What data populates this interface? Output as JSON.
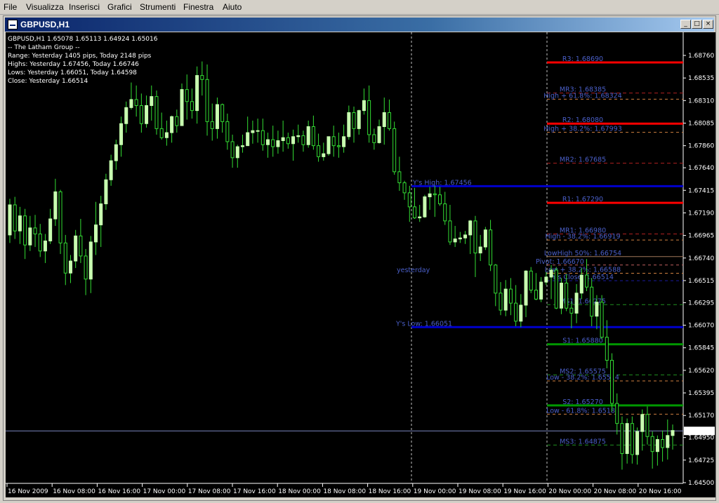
{
  "menu": [
    "File",
    "Visualizza",
    "Inserisci",
    "Grafici",
    "Strumenti",
    "Finestra",
    "Aiuto"
  ],
  "window": {
    "title": "GBPUSD,H1",
    "min": "_",
    "max": "□",
    "close": "×"
  },
  "info": [
    "GBPUSD,H1  1.65078 1.65113 1.64924 1.65016",
    "-- The Latham Group --",
    "Range: Yesterday 1405 pips, Today 2148 pips",
    "Highs: Yesterday 1.67456, Today 1.66746",
    "Lows:  Yesterday 1.66051, Today 1.64598",
    "Close: Yesterday 1.66514"
  ],
  "current_price": "1.65016",
  "colors": {
    "bull": "#c8ffb0",
    "bear": "#000000",
    "wick": "#33dd33",
    "resistance": "#ff0000",
    "support": "#009900",
    "yline": "#0000cc",
    "mid": "#4a5fc8",
    "fib": "#d08040"
  },
  "chart_data": {
    "type": "candlestick",
    "symbol": "GBPUSD",
    "timeframe": "H1",
    "ylim": [
      1.645,
      1.6895
    ],
    "y_ticks": [
      "1.68760",
      "1.68535",
      "1.68310",
      "1.68085",
      "1.67860",
      "1.67640",
      "1.67415",
      "1.67190",
      "1.66965",
      "1.66740",
      "1.66515",
      "1.66295",
      "1.66070",
      "1.65845",
      "1.65620",
      "1.65395",
      "1.65170",
      "1.64950",
      "1.64725",
      "1.64500"
    ],
    "x_ticks": [
      "16 Nov 2009",
      "16 Nov 08:00",
      "16 Nov 16:00",
      "17 Nov 00:00",
      "17 Nov 08:00",
      "17 Nov 16:00",
      "18 Nov 00:00",
      "18 Nov 08:00",
      "18 Nov 16:00",
      "19 Nov 00:00",
      "19 Nov 08:00",
      "19 Nov 16:00",
      "20 Nov 00:00",
      "20 Nov 08:00",
      "20 Nov 16:00"
    ],
    "candles": [
      [
        1.6697,
        1.6733,
        1.6689,
        1.6727
      ],
      [
        1.6727,
        1.6735,
        1.6693,
        1.6701
      ],
      [
        1.6701,
        1.6725,
        1.6688,
        1.6716
      ],
      [
        1.6716,
        1.6723,
        1.6673,
        1.6687
      ],
      [
        1.6687,
        1.6716,
        1.6681,
        1.6704
      ],
      [
        1.6704,
        1.6717,
        1.6685,
        1.6698
      ],
      [
        1.6698,
        1.6708,
        1.6675,
        1.6681
      ],
      [
        1.6681,
        1.6698,
        1.6669,
        1.6691
      ],
      [
        1.6691,
        1.6723,
        1.6688,
        1.6713
      ],
      [
        1.6713,
        1.6753,
        1.6706,
        1.674
      ],
      [
        1.674,
        1.6742,
        1.6678,
        1.6689
      ],
      [
        1.6689,
        1.6697,
        1.6647,
        1.6659
      ],
      [
        1.6659,
        1.6677,
        1.6649,
        1.6671
      ],
      [
        1.6671,
        1.6702,
        1.6664,
        1.6696
      ],
      [
        1.6696,
        1.6713,
        1.6669,
        1.6676
      ],
      [
        1.6676,
        1.6683,
        1.6637,
        1.6653
      ],
      [
        1.6653,
        1.6696,
        1.6639,
        1.669
      ],
      [
        1.669,
        1.673,
        1.6677,
        1.6707
      ],
      [
        1.6707,
        1.6736,
        1.6685,
        1.6728
      ],
      [
        1.6728,
        1.6758,
        1.6722,
        1.6752
      ],
      [
        1.6752,
        1.6777,
        1.6746,
        1.6771
      ],
      [
        1.6771,
        1.6792,
        1.6762,
        1.6787
      ],
      [
        1.6787,
        1.6815,
        1.6775,
        1.6808
      ],
      [
        1.6808,
        1.683,
        1.6799,
        1.6824
      ],
      [
        1.6824,
        1.6849,
        1.6822,
        1.6832
      ],
      [
        1.6832,
        1.6846,
        1.6815,
        1.6826
      ],
      [
        1.6826,
        1.6838,
        1.6799,
        1.6808
      ],
      [
        1.6808,
        1.6836,
        1.6804,
        1.6826
      ],
      [
        1.6826,
        1.6846,
        1.6811,
        1.6835
      ],
      [
        1.6835,
        1.6841,
        1.6797,
        1.6803
      ],
      [
        1.6803,
        1.6819,
        1.6792,
        1.6794
      ],
      [
        1.6794,
        1.6811,
        1.6786,
        1.6799
      ],
      [
        1.6799,
        1.6816,
        1.6789,
        1.6815
      ],
      [
        1.6815,
        1.6822,
        1.6799,
        1.6806
      ],
      [
        1.6806,
        1.6848,
        1.6806,
        1.6842
      ],
      [
        1.6842,
        1.6857,
        1.6812,
        1.683
      ],
      [
        1.683,
        1.6843,
        1.6813,
        1.6821
      ],
      [
        1.6821,
        1.6865,
        1.6808,
        1.6856
      ],
      [
        1.6856,
        1.687,
        1.6836,
        1.6852
      ],
      [
        1.6852,
        1.6867,
        1.6796,
        1.681
      ],
      [
        1.681,
        1.6828,
        1.6791,
        1.6803
      ],
      [
        1.6803,
        1.6834,
        1.6793,
        1.6827
      ],
      [
        1.6827,
        1.6828,
        1.6799,
        1.681
      ],
      [
        1.681,
        1.6818,
        1.6782,
        1.679
      ],
      [
        1.679,
        1.6797,
        1.6764,
        1.6774
      ],
      [
        1.6774,
        1.6787,
        1.6764,
        1.6785
      ],
      [
        1.6785,
        1.6797,
        1.6779,
        1.6786
      ],
      [
        1.6786,
        1.6815,
        1.6786,
        1.6799
      ],
      [
        1.6799,
        1.6811,
        1.6788,
        1.6801
      ],
      [
        1.6801,
        1.6813,
        1.6789,
        1.6801
      ],
      [
        1.6801,
        1.6813,
        1.6781,
        1.6787
      ],
      [
        1.6787,
        1.6799,
        1.6774,
        1.6792
      ],
      [
        1.6792,
        1.6806,
        1.6775,
        1.6785
      ],
      [
        1.6785,
        1.6801,
        1.6778,
        1.6791
      ],
      [
        1.6791,
        1.6811,
        1.678,
        1.6794
      ],
      [
        1.6794,
        1.6799,
        1.6783,
        1.6788
      ],
      [
        1.6788,
        1.6802,
        1.6771,
        1.6795
      ],
      [
        1.6795,
        1.6807,
        1.6789,
        1.6796
      ],
      [
        1.6796,
        1.6801,
        1.678,
        1.6787
      ],
      [
        1.6787,
        1.6811,
        1.6784,
        1.6805
      ],
      [
        1.6805,
        1.6816,
        1.6782,
        1.6786
      ],
      [
        1.6786,
        1.6798,
        1.677,
        1.6775
      ],
      [
        1.6775,
        1.6789,
        1.6771,
        1.6778
      ],
      [
        1.6778,
        1.6795,
        1.6776,
        1.6795
      ],
      [
        1.6795,
        1.6806,
        1.6775,
        1.6786
      ],
      [
        1.6786,
        1.6799,
        1.6774,
        1.6785
      ],
      [
        1.6785,
        1.6807,
        1.6779,
        1.6795
      ],
      [
        1.6795,
        1.6826,
        1.6792,
        1.6819
      ],
      [
        1.6819,
        1.6825,
        1.6789,
        1.6803
      ],
      [
        1.6803,
        1.6822,
        1.6797,
        1.6821
      ],
      [
        1.6821,
        1.6843,
        1.6817,
        1.6831
      ],
      [
        1.6831,
        1.6846,
        1.6789,
        1.6797
      ],
      [
        1.6797,
        1.6803,
        1.6782,
        1.6789
      ],
      [
        1.6789,
        1.6812,
        1.6788,
        1.6805
      ],
      [
        1.6805,
        1.6834,
        1.6787,
        1.6819
      ],
      [
        1.6819,
        1.6832,
        1.6801,
        1.6803
      ],
      [
        1.6803,
        1.681,
        1.6757,
        1.676
      ],
      [
        1.676,
        1.6775,
        1.6741,
        1.6749
      ],
      [
        1.6749,
        1.6751,
        1.6732,
        1.6739
      ],
      [
        1.6739,
        1.6746,
        1.671,
        1.6725
      ],
      [
        1.6725,
        1.6744,
        1.6713,
        1.6714
      ],
      [
        1.6714,
        1.6727,
        1.671,
        1.6715
      ],
      [
        1.6715,
        1.6737,
        1.6714,
        1.6735
      ],
      [
        1.6735,
        1.6745,
        1.6722,
        1.6738
      ],
      [
        1.6738,
        1.6746,
        1.6715,
        1.6737
      ],
      [
        1.6737,
        1.6745,
        1.6726,
        1.6728
      ],
      [
        1.6728,
        1.674,
        1.6707,
        1.6711
      ],
      [
        1.6711,
        1.6727,
        1.6687,
        1.669
      ],
      [
        1.669,
        1.6706,
        1.6685,
        1.6693
      ],
      [
        1.6693,
        1.67,
        1.6689,
        1.6694
      ],
      [
        1.6694,
        1.6701,
        1.6688,
        1.6697
      ],
      [
        1.6697,
        1.6712,
        1.6678,
        1.6711
      ],
      [
        1.6711,
        1.6716,
        1.6655,
        1.6679
      ],
      [
        1.6679,
        1.6697,
        1.6671,
        1.6685
      ],
      [
        1.6685,
        1.6705,
        1.6682,
        1.6702
      ],
      [
        1.6702,
        1.6712,
        1.6661,
        1.6667
      ],
      [
        1.6667,
        1.6668,
        1.6626,
        1.6639
      ],
      [
        1.6639,
        1.665,
        1.6617,
        1.6622
      ],
      [
        1.6622,
        1.6652,
        1.6616,
        1.6643
      ],
      [
        1.6643,
        1.6654,
        1.6617,
        1.6629
      ],
      [
        1.6629,
        1.6647,
        1.6606,
        1.6611
      ],
      [
        1.6611,
        1.6638,
        1.6605,
        1.6627
      ],
      [
        1.6627,
        1.6662,
        1.6615,
        1.6661
      ],
      [
        1.6661,
        1.6665,
        1.6639,
        1.6642
      ],
      [
        1.6642,
        1.6659,
        1.6632,
        1.6633
      ],
      [
        1.6633,
        1.6655,
        1.663,
        1.665
      ],
      [
        1.665,
        1.666,
        1.6647,
        1.6655
      ],
      [
        1.6655,
        1.6667,
        1.6633,
        1.6662
      ],
      [
        1.6662,
        1.6665,
        1.6623,
        1.6624
      ],
      [
        1.6624,
        1.6654,
        1.6618,
        1.6649
      ],
      [
        1.6649,
        1.6658,
        1.6621,
        1.6624
      ],
      [
        1.6624,
        1.6631,
        1.6604,
        1.6619
      ],
      [
        1.6619,
        1.6648,
        1.6609,
        1.6639
      ],
      [
        1.6639,
        1.6664,
        1.6633,
        1.6657
      ],
      [
        1.6657,
        1.6673,
        1.6641,
        1.6645
      ],
      [
        1.6645,
        1.6654,
        1.6606,
        1.6616
      ],
      [
        1.6616,
        1.6637,
        1.6603,
        1.663
      ],
      [
        1.663,
        1.6637,
        1.6593,
        1.6595
      ],
      [
        1.6595,
        1.6612,
        1.6564,
        1.6572
      ],
      [
        1.6572,
        1.6579,
        1.6521,
        1.6529
      ],
      [
        1.6529,
        1.6539,
        1.6498,
        1.6509
      ],
      [
        1.6509,
        1.6516,
        1.6463,
        1.6479
      ],
      [
        1.6479,
        1.6514,
        1.6469,
        1.6509
      ],
      [
        1.6509,
        1.6516,
        1.6469,
        1.6478
      ],
      [
        1.6478,
        1.6505,
        1.6468,
        1.6501
      ],
      [
        1.6501,
        1.6523,
        1.6482,
        1.6518
      ],
      [
        1.6518,
        1.6526,
        1.6488,
        1.6496
      ],
      [
        1.6496,
        1.6501,
        1.6464,
        1.6481
      ],
      [
        1.6481,
        1.6497,
        1.6467,
        1.6493
      ],
      [
        1.6493,
        1.6502,
        1.6471,
        1.6485
      ],
      [
        1.6485,
        1.6513,
        1.6473,
        1.6497
      ],
      [
        1.6497,
        1.6508,
        1.6483,
        1.6502
      ]
    ],
    "levels": [
      {
        "label": "R3: 1.68690",
        "value": 1.6869,
        "kind": "resistance"
      },
      {
        "label": "MR3: 1.68385",
        "value": 1.68385,
        "kind": "mid"
      },
      {
        "label": "High + 61.8%: 1.68324",
        "value": 1.68324,
        "kind": "fib"
      },
      {
        "label": "R2: 1.68080",
        "value": 1.6808,
        "kind": "resistance"
      },
      {
        "label": "High + 38.2%: 1.67993",
        "value": 1.67993,
        "kind": "fib"
      },
      {
        "label": "MR2: 1.67685",
        "value": 1.67685,
        "kind": "mid"
      },
      {
        "label": "Y's High: 1.67456",
        "value": 1.67456,
        "kind": "yline"
      },
      {
        "label": "R1: 1.67290",
        "value": 1.6729,
        "kind": "resistance"
      },
      {
        "label": "MR1: 1.66980",
        "value": 1.6698,
        "kind": "mid"
      },
      {
        "label": "High - 38.2%: 1.66919",
        "value": 1.66919,
        "kind": "fib"
      },
      {
        "label": "LowHigh 50%: 1.66754",
        "value": 1.66754,
        "kind": "lowhigh"
      },
      {
        "label": "Pivot: 1.66670",
        "value": 1.6667,
        "kind": "pivot"
      },
      {
        "label": "Low + 38.2%: 1.66588",
        "value": 1.66588,
        "kind": "fib"
      },
      {
        "label": "Y's Close: 1.66514",
        "value": 1.66514,
        "kind": "yclose"
      },
      {
        "label": "MS1: 1.66275",
        "value": 1.66275,
        "kind": "mid"
      },
      {
        "label": "Y's Low: 1.66051",
        "value": 1.66051,
        "kind": "yline"
      },
      {
        "label": "S1: 1.65880",
        "value": 1.6588,
        "kind": "support"
      },
      {
        "label": "MS2: 1.65575",
        "value": 1.65575,
        "kind": "mid"
      },
      {
        "label": "Low - 38.2%: 1.65514",
        "value": 1.65514,
        "kind": "fib"
      },
      {
        "label": "S2: 1.65270",
        "value": 1.6527,
        "kind": "support"
      },
      {
        "label": "Low - 61.8%: 1.65183",
        "value": 1.65183,
        "kind": "fib"
      },
      {
        "label": "MS3: 1.64875",
        "value": 1.64875,
        "kind": "mid"
      }
    ],
    "yesterday_label": "yesterday"
  }
}
